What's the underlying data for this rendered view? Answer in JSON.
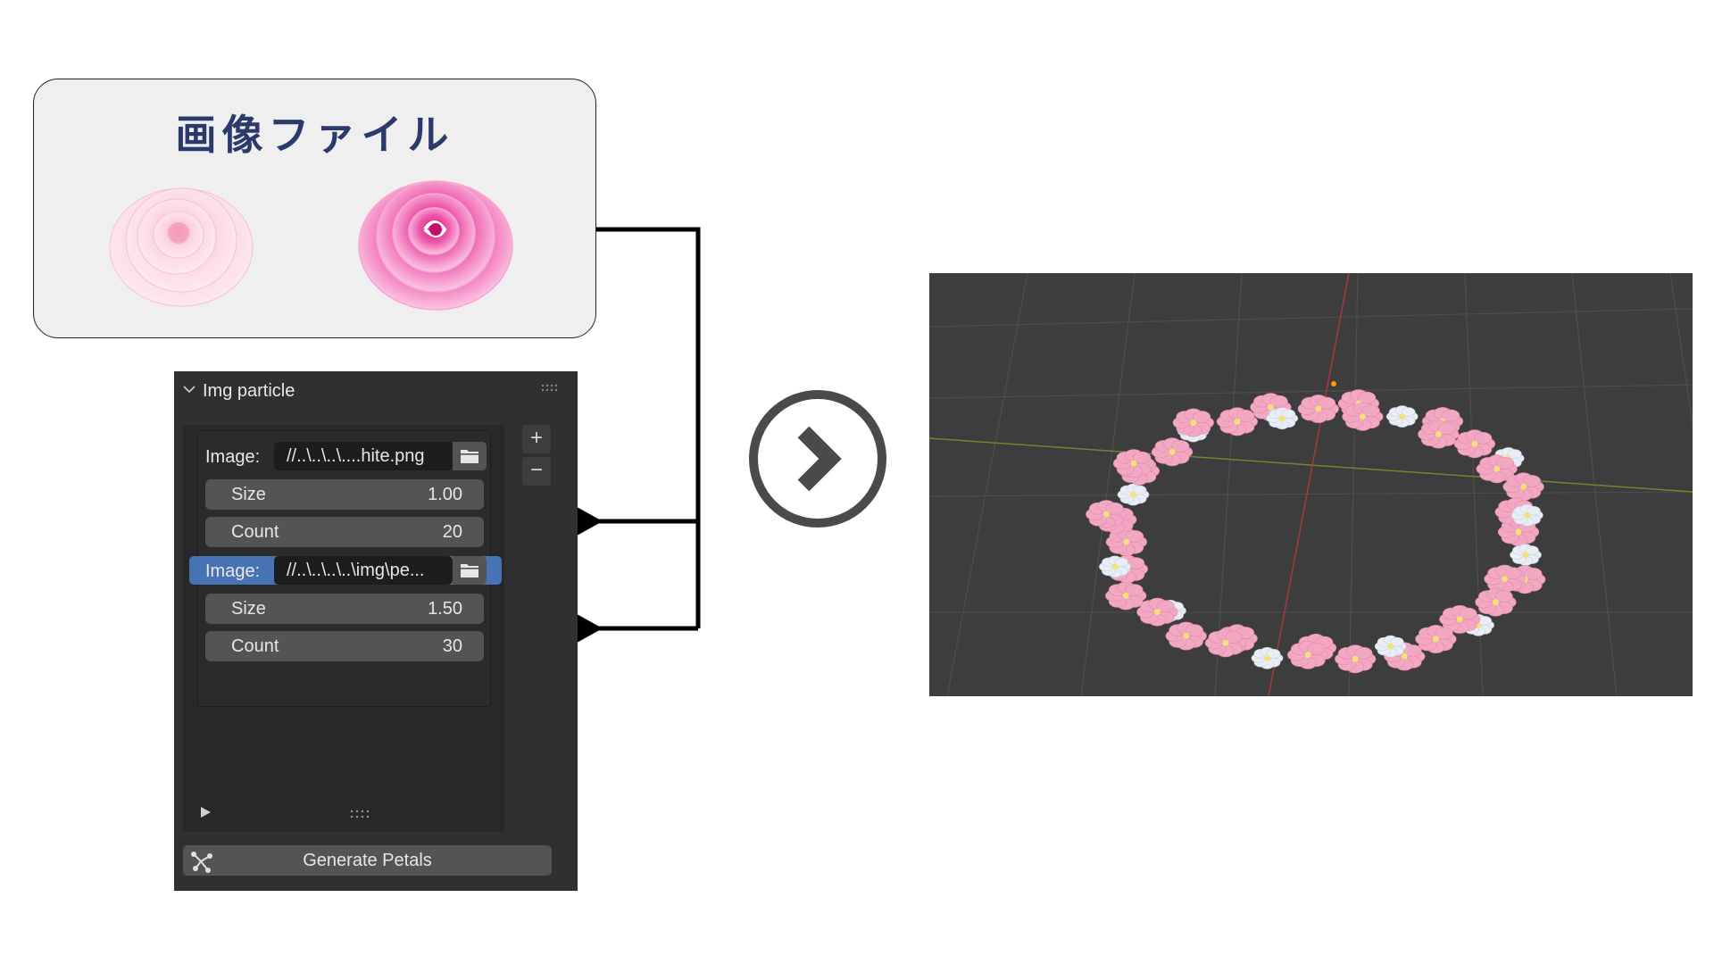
{
  "card": {
    "title": "画像ファイル",
    "images": [
      {
        "name": "rose-white",
        "color": "#f7c6d8"
      },
      {
        "name": "rose-pink",
        "color": "#e54fa8"
      }
    ]
  },
  "panel": {
    "title": "Img particle",
    "items": [
      {
        "image_label": "Image:",
        "path": "//..\\..\\..\\....hite.png",
        "size_label": "Size",
        "size_value": "1.00",
        "count_label": "Count",
        "count_value": "20"
      },
      {
        "image_label": "Image:",
        "path": "//..\\..\\..\\..\\img\\pe...",
        "size_label": "Size",
        "size_value": "1.50",
        "count_label": "Count",
        "count_value": "30"
      }
    ],
    "add_label": "+",
    "remove_label": "−",
    "generate_label": "Generate Petals"
  },
  "colors": {
    "panel_bg": "#303030",
    "field_bg": "#545454",
    "selection": "#4772b3",
    "viewport_bg": "#3d3d3d",
    "card_title": "#2b3a6b"
  }
}
